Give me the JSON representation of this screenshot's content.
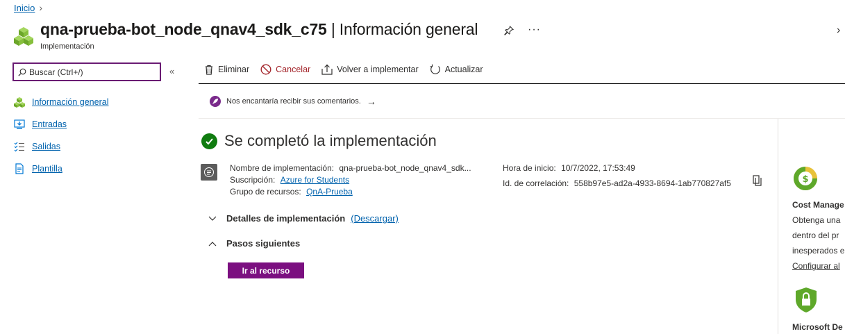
{
  "breadcrumb": {
    "home": "Inicio"
  },
  "header": {
    "title_main": "qna-prueba-bot_node_qnav4_sdk_c75",
    "title_sep": " | ",
    "title_section": "Información general",
    "subtitle": "Implementación",
    "more": "···"
  },
  "search": {
    "placeholder": "Buscar (Ctrl+/)",
    "value": "Buscar (Ctrl+/)",
    "collapse": "«"
  },
  "nav": {
    "items": [
      {
        "label": "Información general",
        "icon": "cubes-icon"
      },
      {
        "label": "Entradas",
        "icon": "inputs-icon"
      },
      {
        "label": "Salidas",
        "icon": "outputs-icon"
      },
      {
        "label": "Plantilla",
        "icon": "template-icon"
      }
    ]
  },
  "toolbar": {
    "delete": "Eliminar",
    "cancel": "Cancelar",
    "redeploy": "Volver a implementar",
    "refresh": "Actualizar"
  },
  "feedback": {
    "text": "Nos encantaría recibir sus comentarios.",
    "arrow": "→"
  },
  "deployment": {
    "status": "Se completó la implementación",
    "name_label": "Nombre de implementación:",
    "name_value": "qna-prueba-bot_node_qnav4_sdk...",
    "subscription_label": "Suscripción:",
    "subscription_value": "Azure for Students",
    "resource_group_label": "Grupo de recursos:",
    "resource_group_value": "QnA-Prueba",
    "start_label": "Hora de inicio:",
    "start_value": "10/7/2022, 17:53:49",
    "correlation_label": "Id. de correlación:",
    "correlation_value": "558b97e5-ad2a-4933-8694-1ab770827af5"
  },
  "sections": {
    "details": "Detalles de implementación",
    "download": "(Descargar)",
    "next_steps": "Pasos siguientes",
    "goto_resource": "Ir al recurso"
  },
  "right_pane": {
    "cost_title": "Cost Manage",
    "cost_line1": "Obtenga una",
    "cost_line2": "dentro del pr",
    "cost_line3": "inesperados e",
    "cost_link": "Configurar al",
    "defender_title": "Microsoft De"
  },
  "colors": {
    "accent": "#7b0f80",
    "link": "#0062ad",
    "success": "#107c10",
    "danger": "#a4262c"
  }
}
